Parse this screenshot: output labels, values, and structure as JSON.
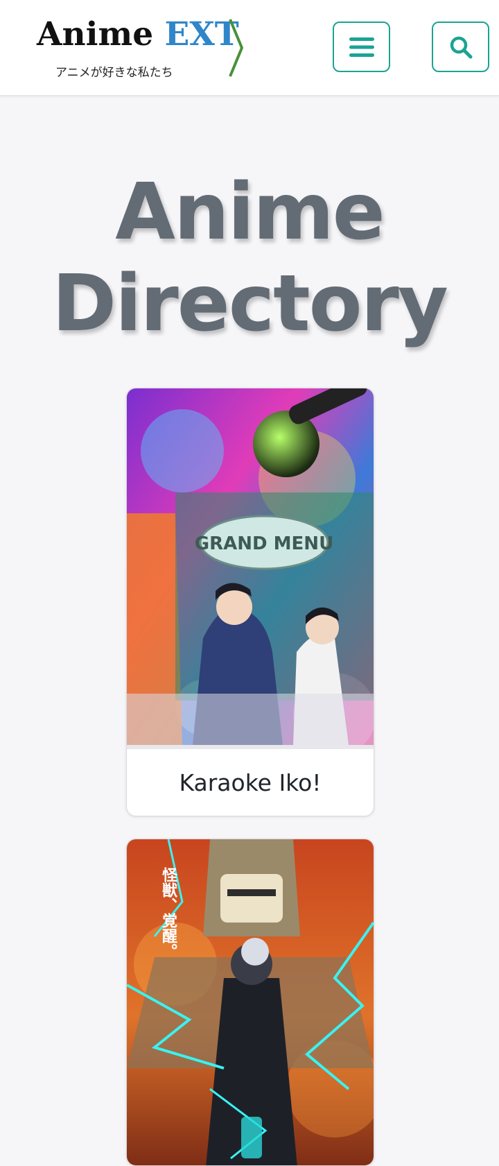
{
  "header": {
    "logo": {
      "title_main": "Anime",
      "title_accent": "EXT",
      "subtitle": "アニメが好きな私たち",
      "accent_color": "#2f86c9",
      "chevron_color": "#4a8f3c"
    },
    "menu_button_icon": "hamburger-menu-icon",
    "search_button_icon": "search-icon",
    "button_color": "#1ba393"
  },
  "main": {
    "title_line1": "Anime",
    "title_line2": "Directory",
    "cards": [
      {
        "title": "Karaoke Iko!",
        "image_text": "GRAND MENU"
      },
      {
        "title": "",
        "image_text": "怪獣、覚醒。"
      }
    ]
  }
}
